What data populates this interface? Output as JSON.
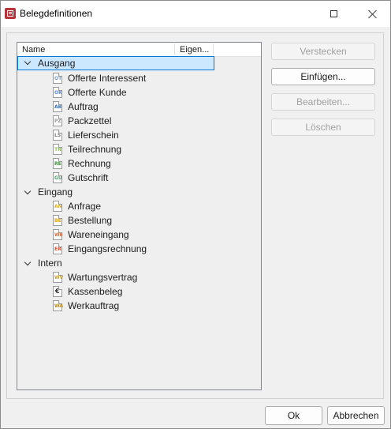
{
  "window": {
    "title": "Belegdefinitionen"
  },
  "tree": {
    "columns": {
      "name": "Name",
      "eigen": "Eigen..."
    },
    "groups": [
      {
        "label": "Ausgang",
        "expanded": true,
        "selected": true,
        "items": [
          {
            "label": "Offerte Interessent",
            "icon": "document-ot-icon",
            "code": "OT",
            "color": "#7a9cc6"
          },
          {
            "label": "Offerte Kunde",
            "icon": "document-ok-icon",
            "code": "OK",
            "color": "#5b8bd0"
          },
          {
            "label": "Auftrag",
            "icon": "document-ab-icon",
            "code": "AB",
            "color": "#3b6fb5"
          },
          {
            "label": "Packzettel",
            "icon": "document-pz-icon",
            "code": "PZ",
            "color": "#9a9a9a"
          },
          {
            "label": "Lieferschein",
            "icon": "document-ls-icon",
            "code": "LS",
            "color": "#7d7d7d"
          },
          {
            "label": "Teilrechnung",
            "icon": "document-tr-icon",
            "code": "TR",
            "color": "#8cbf5a"
          },
          {
            "label": "Rechnung",
            "icon": "document-re-icon",
            "code": "RE",
            "color": "#3e8f3e"
          },
          {
            "label": "Gutschrift",
            "icon": "document-gu-icon",
            "code": "GU",
            "color": "#4e9a6e"
          }
        ]
      },
      {
        "label": "Eingang",
        "expanded": true,
        "selected": false,
        "items": [
          {
            "label": "Anfrage",
            "icon": "document-an-icon",
            "code": "AN",
            "color": "#e0b030"
          },
          {
            "label": "Bestellung",
            "icon": "document-be-icon",
            "code": "BE",
            "color": "#e0a020"
          },
          {
            "label": "Wareneingang",
            "icon": "document-we-icon",
            "code": "WE",
            "color": "#d86a3a"
          },
          {
            "label": "Eingangsrechnung",
            "icon": "document-er-icon",
            "code": "ER",
            "color": "#d05030"
          }
        ]
      },
      {
        "label": "Intern",
        "expanded": true,
        "selected": false,
        "items": [
          {
            "label": "Wartungsvertrag",
            "icon": "document-wv-icon",
            "code": "WV",
            "color": "#c8a030"
          },
          {
            "label": "Kassenbeleg",
            "icon": "document-euro-icon",
            "code": "€",
            "color": "#2f2f2f"
          },
          {
            "label": "Werkauftrag",
            "icon": "document-wa-icon",
            "code": "WA",
            "color": "#b58a20"
          }
        ]
      }
    ]
  },
  "side_buttons": {
    "hide": "Verstecken",
    "insert": "Einfügen...",
    "edit": "Bearbeiten...",
    "delete": "Löschen"
  },
  "footer": {
    "ok": "Ok",
    "cancel": "Abbrechen"
  }
}
